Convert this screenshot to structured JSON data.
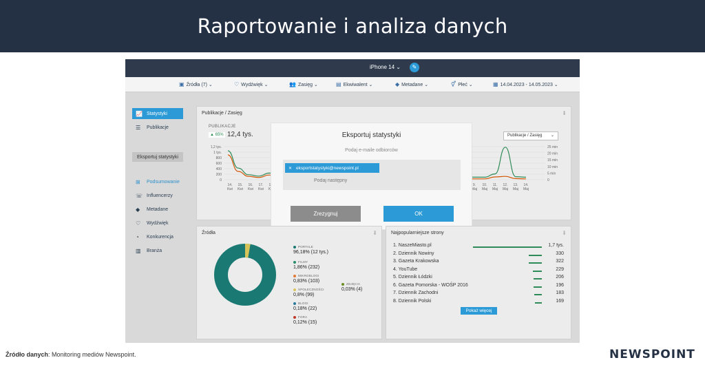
{
  "slide": {
    "title": "Raportowanie i analiza danych",
    "source_label": "Źródło danych",
    "source_text": ": Monitoring mediów Newspoint.",
    "logo": "NEWSPOINT"
  },
  "app": {
    "device": "iPhone 14",
    "filters": [
      {
        "icon": "calendar-icon",
        "label": "Źródła (7)"
      },
      {
        "icon": "heart-icon",
        "label": "Wydźwięk"
      },
      {
        "icon": "users-icon",
        "label": "Zasięg"
      },
      {
        "icon": "money-icon",
        "label": "Ekwiwalent"
      },
      {
        "icon": "tags-icon",
        "label": "Metadane"
      },
      {
        "icon": "gender-icon",
        "label": "Płeć"
      },
      {
        "icon": "calendar-icon",
        "label": "14.04.2023 - 14.05.2023"
      }
    ],
    "sidebar": {
      "items": [
        {
          "label": "Statystyki",
          "icon": "chart-icon"
        },
        {
          "label": "Publikacje",
          "icon": "list-icon"
        }
      ],
      "export_label": "Eksportuj statystyki",
      "nav": [
        {
          "label": "Podsumowanie",
          "icon": "presentation-icon"
        },
        {
          "label": "Influencerzy",
          "icon": "user-icon"
        },
        {
          "label": "Metadane",
          "icon": "tags-icon"
        },
        {
          "label": "Wydźwięk",
          "icon": "heart-icon"
        },
        {
          "label": "Konkurencja",
          "icon": "pie-icon"
        },
        {
          "label": "Branża",
          "icon": "building-icon"
        }
      ]
    },
    "publications": {
      "title": "Publikacje / Zasięg",
      "label": "PUBLIKACJE",
      "change": "▲ 65%",
      "value": "12,4 tys.",
      "select": "Publikacje / Zasięg"
    },
    "modal": {
      "title": "Eksportuj statystyki",
      "subtitle": "Podaj e-maile odbiorców",
      "email_tag": "eksportstatystyki@newspoint.pl",
      "input_placeholder": "Podaj następny",
      "cancel": "Zrezygnuj",
      "ok": "OK"
    },
    "sources": {
      "title": "Źródła",
      "items": [
        {
          "name": "PORTALE",
          "value": "96,18% (12 tys.)",
          "color": "#1a7a73"
        },
        {
          "name": "FILMY",
          "value": "1,86% (232)",
          "color": "#2a8f6a"
        },
        {
          "name": "MIKROBLOGI",
          "value": "0,83% (103)",
          "color": "#e07a35"
        },
        {
          "name": "SPOŁECZNOŚCI",
          "value": "0,8% (99)",
          "color": "#d6c45a"
        },
        {
          "name": "BLOGI",
          "value": "0,18% (22)",
          "color": "#2c7a9a"
        },
        {
          "name": "FORA",
          "value": "0,12% (15)",
          "color": "#c0392b"
        },
        {
          "name": "ZDJĘCIA",
          "value": "0,03% (4)",
          "color": "#6b8e23"
        }
      ]
    },
    "top_sites": {
      "title": "Najpopularniejsze strony",
      "rows": [
        {
          "name": "1.  NaszeMiasto.pl",
          "value": "1,7 tys.",
          "share": 1.0
        },
        {
          "name": "2.  Dziennik Nowiny",
          "value": "330",
          "share": 0.19
        },
        {
          "name": "3.  Gazeta Krakowska",
          "value": "322",
          "share": 0.19
        },
        {
          "name": "4.  YouTube",
          "value": "229",
          "share": 0.13
        },
        {
          "name": "5.  Dziennik Łódzki",
          "value": "206",
          "share": 0.12
        },
        {
          "name": "6.  Gazeta Pomorska - WOŚP 2016",
          "value": "196",
          "share": 0.12
        },
        {
          "name": "7.  Dziennik Zachodni",
          "value": "183",
          "share": 0.11
        },
        {
          "name": "8.  Dziennik Polski",
          "value": "169",
          "share": 0.1
        }
      ],
      "more": "Pokaż więcej"
    },
    "chart_data": {
      "type": "line",
      "y_left_ticks": [
        "1,2 tys.",
        "1 tys.",
        "800",
        "600",
        "400",
        "200",
        "0"
      ],
      "y_right_ticks": [
        "25 min",
        "20 min",
        "15 min",
        "10 min",
        "5 min",
        "0"
      ],
      "x_left": [
        "14. Kwi",
        "15. Kwi",
        "16. Kwi",
        "17. Kwi",
        "18. Kwi"
      ],
      "x_right": [
        "9. Maj",
        "10. Maj",
        "11. Maj",
        "12. Maj",
        "13. Maj",
        "14. Maj"
      ],
      "series": [
        {
          "name": "",
          "color": "#2e8b57",
          "values": [
            1050,
            420,
            180,
            130,
            240,
            120,
            90,
            210,
            1180,
            110,
            90
          ]
        },
        {
          "name": "",
          "color": "#d35400",
          "values": [
            900,
            300,
            120,
            80,
            170,
            50,
            30,
            100,
            120,
            40,
            30
          ]
        }
      ]
    }
  }
}
